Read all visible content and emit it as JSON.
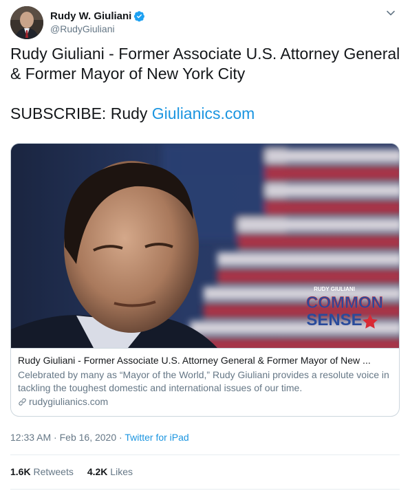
{
  "author": {
    "display_name": "Rudy W. Giuliani",
    "handle": "@RudyGiuliani",
    "avatar_icon": "user-avatar",
    "verified_icon": "verified-badge-icon",
    "verified_color": "#1da1f2"
  },
  "tweet": {
    "line1": "Rudy Giuliani - Former Associate U.S. Attorney General",
    "line2": "& Former Mayor of New York City",
    "subscribe_prefix": "SUBSCRIBE: Rudy ",
    "subscribe_link": "Giulianics.com",
    "link_color": "#1b95e0"
  },
  "card": {
    "image_logo_small": "RUDY GIULIANI",
    "image_logo_word1": "COMMON",
    "image_logo_word2": "SENSE",
    "title": "Rudy Giuliani - Former Associate U.S. Attorney General & Former Mayor of New ...",
    "description": "Celebrated by many as “Mayor of the World,” Rudy Giuliani provides a resolute voice in tackling the toughest domestic and international issues of our time.",
    "domain": "rudygiulianics.com"
  },
  "meta": {
    "time": "12:33 AM",
    "separator": " · ",
    "date": "Feb 16, 2020",
    "source": "Twitter for iPad"
  },
  "stats": {
    "retweets_count": "1.6K",
    "retweets_label": "Retweets",
    "likes_count": "4.2K",
    "likes_label": "Likes"
  }
}
